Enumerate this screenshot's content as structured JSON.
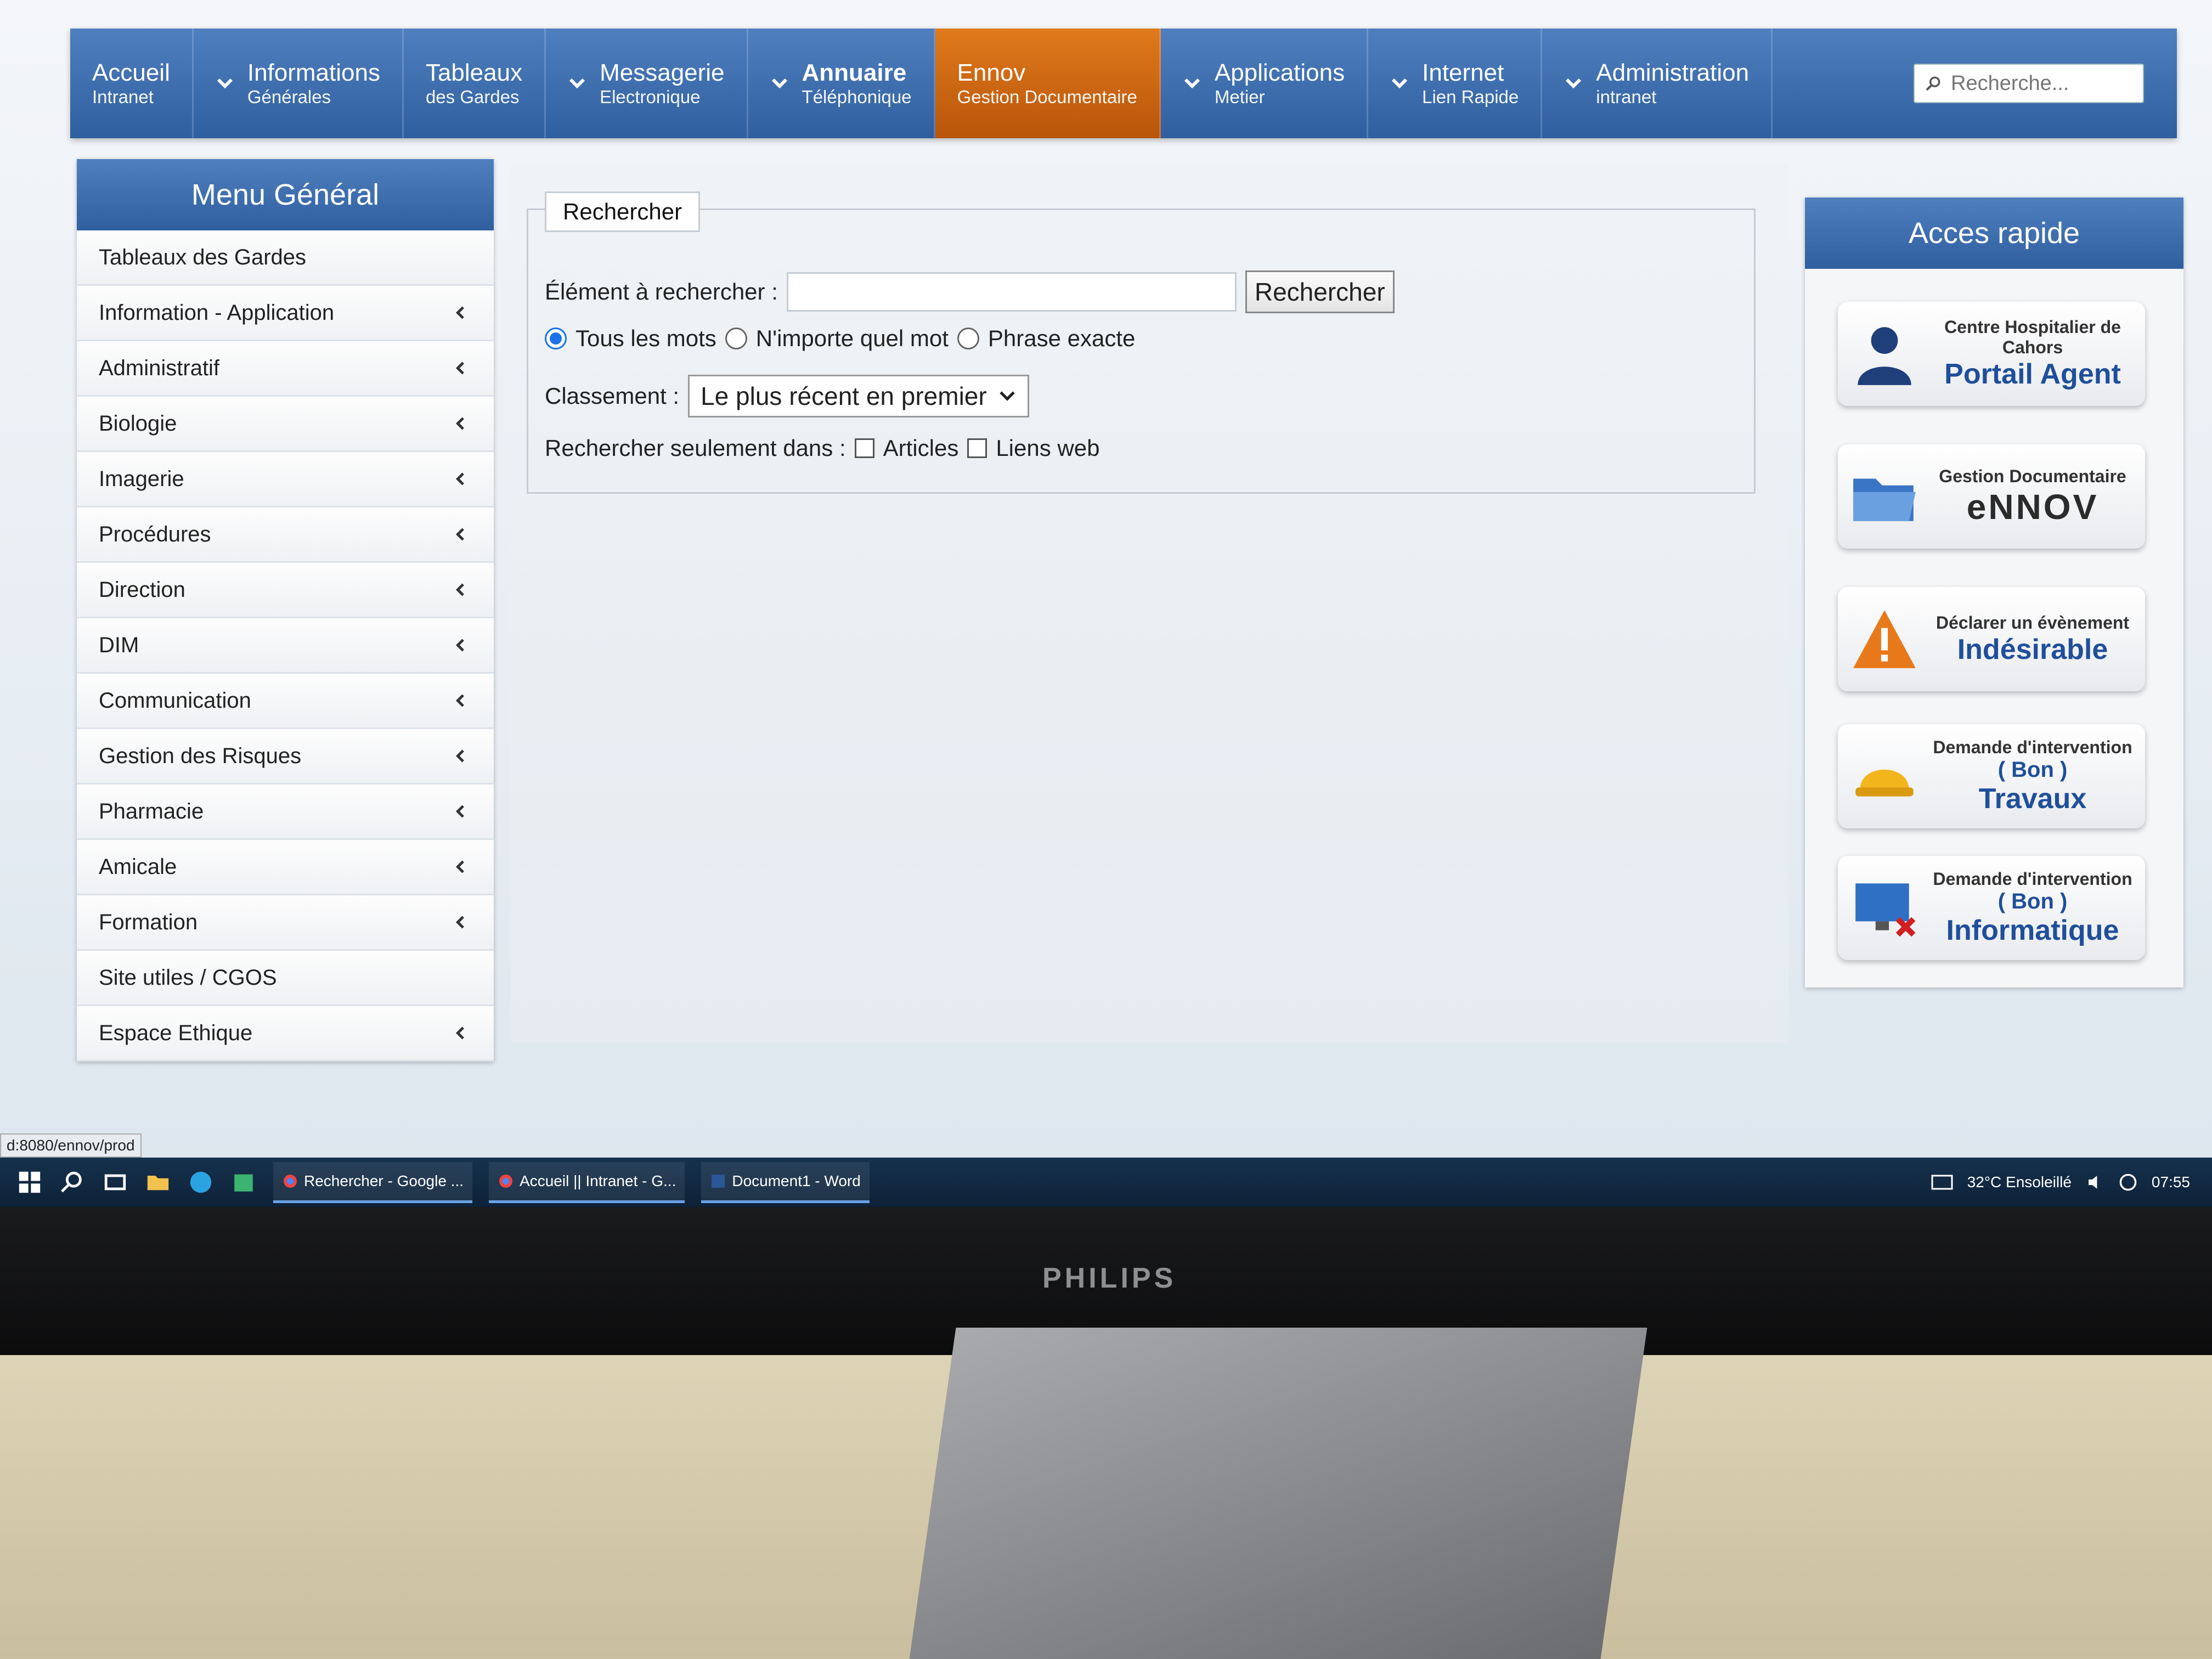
{
  "nav": {
    "items": [
      {
        "main": "Accueil",
        "sub": "Intranet",
        "chevron": false,
        "active": false
      },
      {
        "main": "Informations",
        "sub": "Générales",
        "chevron": true,
        "active": false
      },
      {
        "main": "Tableaux",
        "sub": "des Gardes",
        "chevron": false,
        "active": false
      },
      {
        "main": "Messagerie",
        "sub": "Electronique",
        "chevron": true,
        "active": false
      },
      {
        "main": "Annuaire",
        "sub": "Téléphonique",
        "chevron": true,
        "active": false
      },
      {
        "main": "Ennov",
        "sub": "Gestion Documentaire",
        "chevron": false,
        "active": true
      },
      {
        "main": "Applications",
        "sub": "Metier",
        "chevron": true,
        "active": false
      },
      {
        "main": "Internet",
        "sub": "Lien Rapide",
        "chevron": true,
        "active": false
      },
      {
        "main": "Administration",
        "sub": "intranet",
        "chevron": true,
        "active": false
      }
    ],
    "search_placeholder": "Recherche..."
  },
  "sidebar": {
    "title": "Menu Général",
    "items": [
      {
        "label": "Tableaux des Gardes",
        "chevron": false
      },
      {
        "label": "Information - Application",
        "chevron": true
      },
      {
        "label": "Administratif",
        "chevron": true
      },
      {
        "label": "Biologie",
        "chevron": true
      },
      {
        "label": "Imagerie",
        "chevron": true
      },
      {
        "label": "Procédures",
        "chevron": true
      },
      {
        "label": "Direction",
        "chevron": true
      },
      {
        "label": "DIM",
        "chevron": true
      },
      {
        "label": "Communication",
        "chevron": true
      },
      {
        "label": "Gestion des Risques",
        "chevron": true
      },
      {
        "label": "Pharmacie",
        "chevron": true
      },
      {
        "label": "Amicale",
        "chevron": true
      },
      {
        "label": "Formation",
        "chevron": true
      },
      {
        "label": "Site utiles / CGOS",
        "chevron": false
      },
      {
        "label": "Espace Ethique",
        "chevron": true
      }
    ]
  },
  "search": {
    "legend": "Rechercher",
    "element_label": "Élément à rechercher :",
    "element_value": "",
    "button_label": "Rechercher",
    "radios": [
      {
        "label": "Tous les mots",
        "checked": true
      },
      {
        "label": "N'importe quel mot",
        "checked": false
      },
      {
        "label": "Phrase exacte",
        "checked": false
      }
    ],
    "sort_label": "Classement :",
    "sort_value": "Le plus récent en premier",
    "only_in_label": "Rechercher seulement dans :",
    "checkboxes": [
      {
        "label": "Articles",
        "checked": false
      },
      {
        "label": "Liens web",
        "checked": false
      }
    ]
  },
  "quick_access": {
    "title": "Acces rapide",
    "cards": [
      {
        "small": "Centre Hospitalier de Cahors",
        "big": "Portail Agent",
        "icon": "user-icon"
      },
      {
        "small": "Gestion Documentaire",
        "big": "eNNOV",
        "icon": "folder-icon"
      },
      {
        "small": "Déclarer un évènement",
        "big": "Indésirable",
        "icon": "warning-icon"
      },
      {
        "small": "Demande d'intervention",
        "mid": "( Bon )",
        "big": "Travaux",
        "icon": "hardhat-icon"
      },
      {
        "small": "Demande d'intervention",
        "mid": "( Bon )",
        "big": "Informatique",
        "icon": "computer-icon"
      }
    ]
  },
  "status_url": "d:8080/ennov/prod",
  "taskbar": {
    "apps": [
      "Rechercher - Google ...",
      "Accueil || Intranet - G...",
      "Document1 - Word"
    ],
    "weather": "32°C  Ensoleillé",
    "time": "07:55"
  },
  "monitor_brand": "PHILIPS",
  "colors": {
    "nav_blue": "#2f5f9f",
    "active_orange": "#d06a12",
    "link_blue": "#1f4f9a"
  }
}
